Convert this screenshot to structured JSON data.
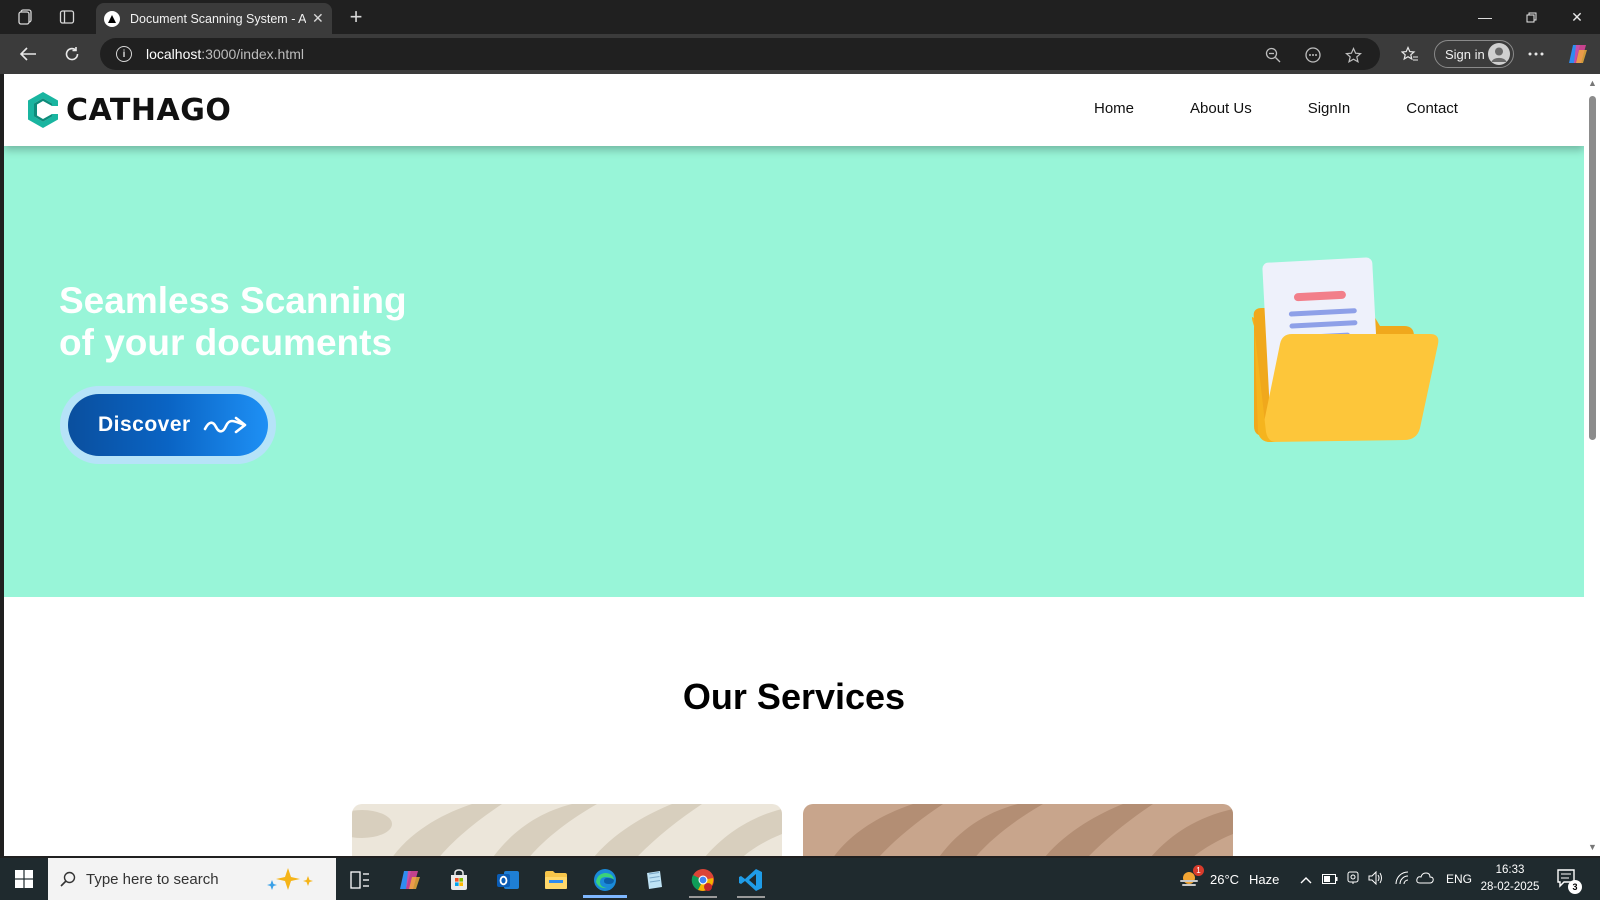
{
  "browser": {
    "tab_title": "Document Scanning System - Aut",
    "url_host": "localhost",
    "url_path": ":3000/index.html",
    "signin_label": "Sign in"
  },
  "site": {
    "logo_text": "CATHAGO",
    "nav": [
      "Home",
      "About Us",
      "SignIn",
      "Contact"
    ],
    "hero_line1": "Seamless Scanning",
    "hero_line2": "of your documents",
    "cta_label": "Discover",
    "services_title": "Our Services",
    "colors": {
      "hero_bg": "#98f5d8",
      "cta_start": "#0a4f9e",
      "cta_end": "#1e90f5",
      "logo_teal": "#19b5a0"
    }
  },
  "taskbar": {
    "search_placeholder": "Type here to search",
    "weather_temp": "26°C",
    "weather_desc": "Haze",
    "language": "ENG",
    "time": "16:33",
    "date": "28-02-2025",
    "weather_alert_count": "1",
    "notification_count": "3"
  }
}
